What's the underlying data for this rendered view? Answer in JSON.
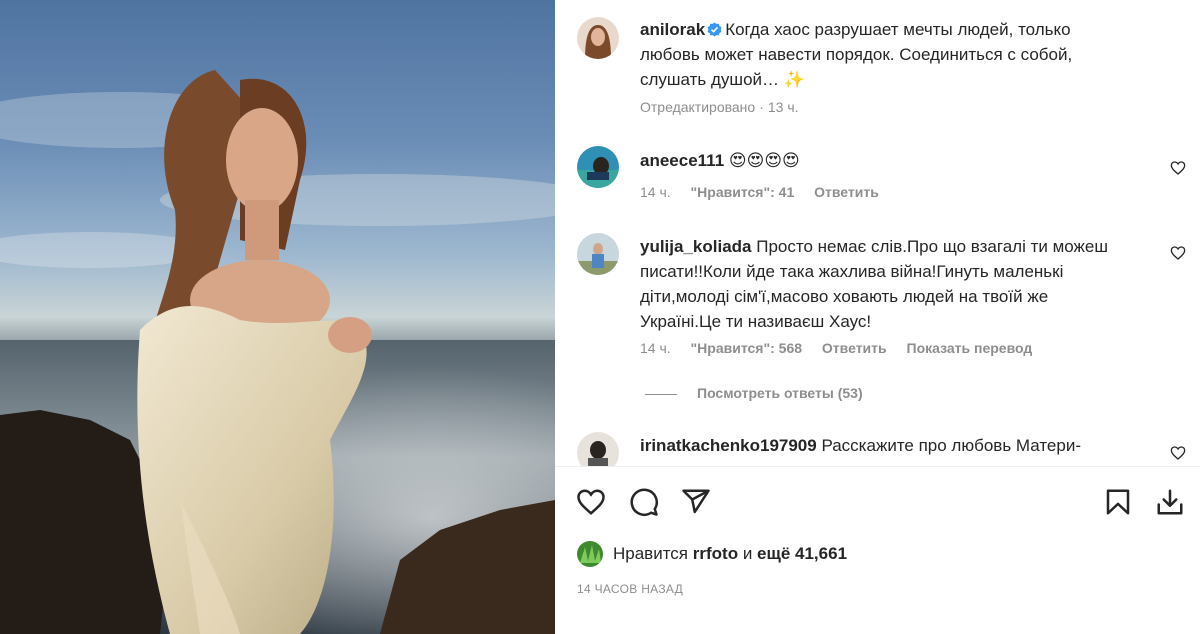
{
  "photo": {
    "alt": "woman in white dress by the sea"
  },
  "post": {
    "author": "anilorak",
    "caption": "Когда хаос разрушает мечты людей, только любовь может навести порядок. Соединиться с собой, слушать душой… ✨",
    "edited_label": "Отредактировано",
    "time": "13 ч."
  },
  "comments": [
    {
      "username": "aneece111",
      "text": "😍😍😍😍",
      "time": "14 ч.",
      "likes_label": "\"Нравится\": 41",
      "reply_label": "Ответить"
    },
    {
      "username": "yulija_koliada",
      "text": "Просто немає слів.Про що взагалі ти можеш писати!!Коли йде така жахлива війна!Гинуть маленькі діти,молоді сім'ї,масово ховають людей на твоїй же Україні.Це ти називаєш Хаус!",
      "time": "14 ч.",
      "likes_label": "\"Нравится\": 568",
      "reply_label": "Ответить",
      "translate_label": "Показать перевод",
      "view_replies": "Посмотреть ответы (53)"
    },
    {
      "username": "irinatkachenko197909",
      "text": "Расскажите про любовь Матери-"
    }
  ],
  "likes": {
    "prefix": "Нравится",
    "user": "rrfoto",
    "and": "и",
    "others": "ещё 41,661"
  },
  "posted_ago": "14 ЧАСОВ НАЗАД",
  "icons": {
    "like": "heart-icon",
    "comment": "comment-icon",
    "share": "share-icon",
    "save": "bookmark-icon",
    "download": "download-icon",
    "verified": "verified-badge-icon"
  },
  "colors": {
    "verified": "#3897f0",
    "muted": "#8e8e8e",
    "text": "#262626"
  }
}
